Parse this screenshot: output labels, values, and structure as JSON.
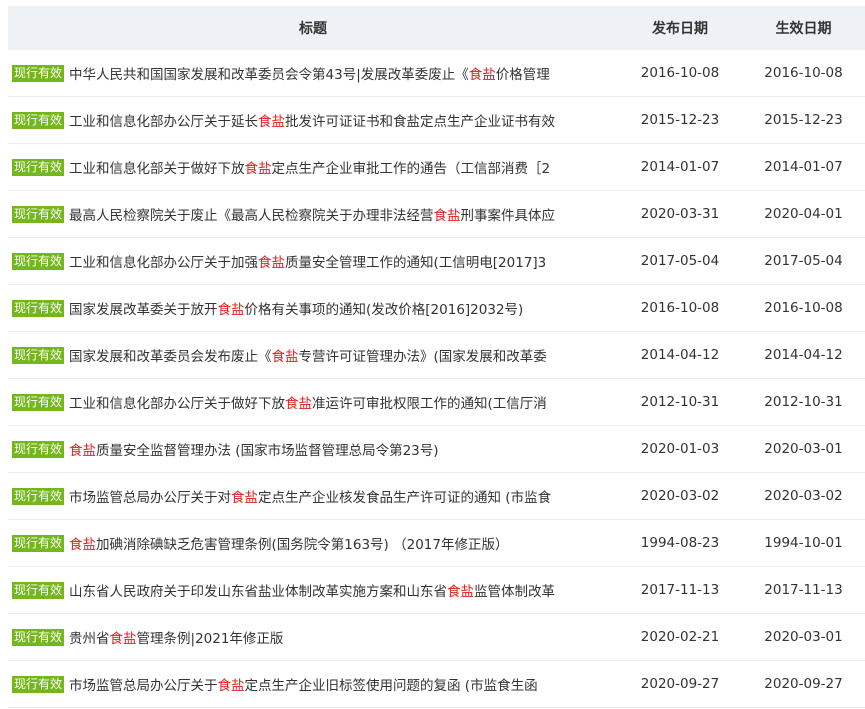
{
  "header": {
    "title": "标题",
    "published": "发布日期",
    "effective": "生效日期"
  },
  "colors": {
    "badge": "#74b71b",
    "highlight": "#e02020",
    "header_bg": "#eef1f6"
  },
  "rows": [
    {
      "status": "现行有效",
      "before": "中华人民共和国国家发展和改革委员会令第43号|发展改革委废止《",
      "hl": "食盐",
      "after": "价格管理",
      "published": "2016-10-08",
      "effective": "2016-10-08"
    },
    {
      "status": "现行有效",
      "before": "工业和信息化部办公厅关于延长",
      "hl": "食盐",
      "after": "批发许可证证书和食盐定点生产企业证书有效",
      "published": "2015-12-23",
      "effective": "2015-12-23"
    },
    {
      "status": "现行有效",
      "before": "工业和信息化部关于做好下放",
      "hl": "食盐",
      "after": "定点生产企业审批工作的通告（工信部消费［2",
      "published": "2014-01-07",
      "effective": "2014-01-07"
    },
    {
      "status": "现行有效",
      "before": "最高人民检察院关于废止《最高人民检察院关于办理非法经营",
      "hl": "食盐",
      "after": "刑事案件具体应",
      "published": "2020-03-31",
      "effective": "2020-04-01"
    },
    {
      "status": "现行有效",
      "before": "工业和信息化部办公厅关于加强",
      "hl": "食盐",
      "after": "质量安全管理工作的通知(工信明电[2017]3",
      "published": "2017-05-04",
      "effective": "2017-05-04"
    },
    {
      "status": "现行有效",
      "before": "国家发展改革委关于放开",
      "hl": "食盐",
      "after": "价格有关事项的通知(发改价格[2016]2032号)",
      "published": "2016-10-08",
      "effective": "2016-10-08"
    },
    {
      "status": "现行有效",
      "before": "国家发展和改革委员会发布废止《",
      "hl": "食盐",
      "after": "专营许可证管理办法》(国家发展和改革委",
      "published": "2014-04-12",
      "effective": "2014-04-12"
    },
    {
      "status": "现行有效",
      "before": "工业和信息化部办公厅关于做好下放",
      "hl": "食盐",
      "after": "准运许可审批权限工作的通知(工信厅消",
      "published": "2012-10-31",
      "effective": "2012-10-31"
    },
    {
      "status": "现行有效",
      "before": "",
      "hl": "食盐",
      "after": "质量安全监督管理办法 (国家市场监督管理总局令第23号)",
      "published": "2020-01-03",
      "effective": "2020-03-01"
    },
    {
      "status": "现行有效",
      "before": "市场监管总局办公厅关于对",
      "hl": "食盐",
      "after": "定点生产企业核发食品生产许可证的通知 (市监食",
      "published": "2020-03-02",
      "effective": "2020-03-02"
    },
    {
      "status": "现行有效",
      "before": "",
      "hl": "食盐",
      "after": "加碘消除碘缺乏危害管理条例(国务院令第163号) （2017年修正版）",
      "published": "1994-08-23",
      "effective": "1994-10-01"
    },
    {
      "status": "现行有效",
      "before": "山东省人民政府关于印发山东省盐业体制改革实施方案和山东省",
      "hl": "食盐",
      "after": "监管体制改革",
      "published": "2017-11-13",
      "effective": "2017-11-13"
    },
    {
      "status": "现行有效",
      "before": "贵州省",
      "hl": "食盐",
      "after": "管理条例|2021年修正版",
      "published": "2020-02-21",
      "effective": "2020-03-01"
    },
    {
      "status": "现行有效",
      "before": "市场监管总局办公厅关于",
      "hl": "食盐",
      "after": "定点生产企业旧标签使用问题的复函 (市监食生函",
      "published": "2020-09-27",
      "effective": "2020-09-27"
    }
  ]
}
